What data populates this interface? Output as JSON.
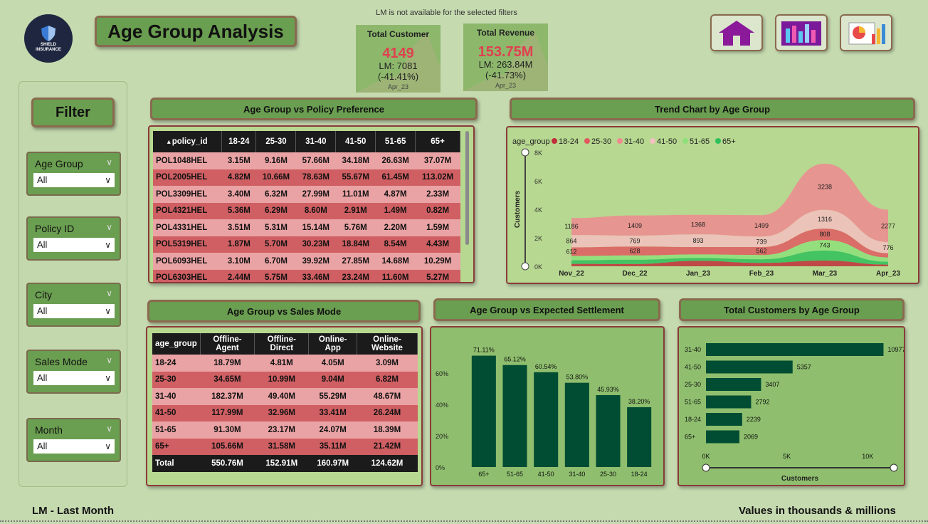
{
  "header": {
    "title": "Age Group Analysis",
    "logo_text": [
      "SHIELD",
      "INSURANCE"
    ],
    "notice": "LM is not available for the selected filters",
    "nav_buttons": [
      "home-icon",
      "dashboard-icon",
      "report-icon"
    ]
  },
  "kpis": [
    {
      "label": "Total Customer",
      "value": "4149",
      "lm": "LM: 7081",
      "change": "(-41.41%)",
      "date": "Apr_23"
    },
    {
      "label": "Total Revenue",
      "value": "153.75M",
      "lm": "LM: 263.84M",
      "change": "(-41.73%)",
      "date": "Apr_23"
    }
  ],
  "filters": {
    "title": "Filter",
    "slicers": [
      {
        "label": "Age Group",
        "value": "All"
      },
      {
        "label": "Policy ID",
        "value": "All"
      },
      {
        "label": "City",
        "value": "All"
      },
      {
        "label": "Sales Mode",
        "value": "All"
      },
      {
        "label": "Month",
        "value": "All"
      }
    ]
  },
  "policy_table": {
    "title": "Age Group vs Policy Preference",
    "columns": [
      "policy_id",
      "18-24",
      "25-30",
      "31-40",
      "41-50",
      "51-65",
      "65+"
    ],
    "rows": [
      [
        "POL1048HEL",
        "3.15M",
        "9.16M",
        "57.66M",
        "34.18M",
        "26.63M",
        "37.07M"
      ],
      [
        "POL2005HEL",
        "4.82M",
        "10.66M",
        "78.63M",
        "55.67M",
        "61.45M",
        "113.02M"
      ],
      [
        "POL3309HEL",
        "3.40M",
        "6.32M",
        "27.99M",
        "11.01M",
        "4.87M",
        "2.33M"
      ],
      [
        "POL4321HEL",
        "5.36M",
        "6.29M",
        "8.60M",
        "2.91M",
        "1.49M",
        "0.82M"
      ],
      [
        "POL4331HEL",
        "3.51M",
        "5.31M",
        "15.14M",
        "5.76M",
        "2.20M",
        "1.59M"
      ],
      [
        "POL5319HEL",
        "1.87M",
        "5.70M",
        "30.23M",
        "18.84M",
        "8.54M",
        "4.43M"
      ],
      [
        "POL6093HEL",
        "3.10M",
        "6.70M",
        "39.92M",
        "27.85M",
        "14.68M",
        "10.29M"
      ],
      [
        "POL6303HEL",
        "2.44M",
        "5.75M",
        "33.46M",
        "23.24M",
        "11.60M",
        "5.27M"
      ]
    ]
  },
  "sales_table": {
    "title": "Age Group vs Sales Mode",
    "columns": [
      "age_group",
      "Offline-Agent",
      "Offline-Direct",
      "Online-App",
      "Online-Website"
    ],
    "rows": [
      [
        "18-24",
        "18.79M",
        "4.81M",
        "4.05M",
        "3.09M"
      ],
      [
        "25-30",
        "34.65M",
        "10.99M",
        "9.04M",
        "6.82M"
      ],
      [
        "31-40",
        "182.37M",
        "49.40M",
        "55.29M",
        "48.67M"
      ],
      [
        "41-50",
        "117.99M",
        "32.96M",
        "33.41M",
        "26.24M"
      ],
      [
        "51-65",
        "91.30M",
        "23.17M",
        "24.07M",
        "18.39M"
      ],
      [
        "65+",
        "105.66M",
        "31.58M",
        "35.11M",
        "21.42M"
      ]
    ],
    "total": [
      "Total",
      "550.76M",
      "152.91M",
      "160.97M",
      "124.62M"
    ]
  },
  "footer": {
    "left": "LM - Last Month",
    "right": "Values in thousands & millions"
  },
  "chart_data": [
    {
      "type": "area",
      "title": "Trend Chart by Age Group",
      "legend_title": "age_group",
      "legend_position": "top-left",
      "ylabel": "Customers",
      "xlabel": "",
      "categories": [
        "Nov_22",
        "Dec_22",
        "Jan_23",
        "Feb_23",
        "Mar_23",
        "Apr_23"
      ],
      "yticks": [
        "0K",
        "2K",
        "4K",
        "6K",
        "8K"
      ],
      "ylim": [
        0,
        8000
      ],
      "series": [
        {
          "name": "18-24",
          "color": "#c0303a",
          "values": [
            170,
            160,
            380,
            240,
            400,
            120
          ]
        },
        {
          "name": "25-30",
          "color": "#e05a60",
          "values": [
            612,
            628,
            520,
            562,
            808,
            300
          ]
        },
        {
          "name": "31-40",
          "color": "#f08a90",
          "values": [
            1186,
            1409,
            1368,
            1499,
            3238,
            2277
          ]
        },
        {
          "name": "41-50",
          "color": "#f5c0c0",
          "values": [
            864,
            769,
            893,
            739,
            1316,
            776
          ]
        },
        {
          "name": "51-65",
          "color": "#8ee07a",
          "values": [
            300,
            300,
            250,
            300,
            743,
            300
          ]
        },
        {
          "name": "65+",
          "color": "#2fbf5a",
          "values": [
            250,
            300,
            200,
            250,
            700,
            200
          ]
        }
      ],
      "data_labels": {
        "Nov_22": [
          "1186",
          "864",
          "612"
        ],
        "Dec_22": [
          "1409",
          "769",
          "628"
        ],
        "Jan_23": [
          "1368",
          "893"
        ],
        "Feb_23": [
          "1499",
          "739",
          "562"
        ],
        "Mar_23": [
          "3238",
          "1316",
          "808",
          "743"
        ],
        "Apr_23": [
          "2277",
          "776"
        ]
      },
      "colors": {
        "legend": [
          "#c0303a",
          "#e05a60",
          "#f08a90",
          "#f5c0c0",
          "#8ee07a",
          "#2fbf5a"
        ]
      }
    },
    {
      "type": "bar",
      "title": "Age Group vs Expected Settlement",
      "categories": [
        "65+",
        "51-65",
        "41-50",
        "31-40",
        "25-30",
        "18-24"
      ],
      "values": [
        71.11,
        65.12,
        60.54,
        53.8,
        45.93,
        38.2
      ],
      "labels": [
        "71.11%",
        "65.12%",
        "60.54%",
        "53.80%",
        "45.93%",
        "38.20%"
      ],
      "yticks": [
        "0%",
        "20%",
        "40%",
        "60%"
      ],
      "ylim": [
        0,
        80
      ],
      "color": "#004d33"
    },
    {
      "type": "bar",
      "orientation": "horizontal",
      "title": "Total Customers by Age Group",
      "categories": [
        "31-40",
        "41-50",
        "25-30",
        "51-65",
        "18-24",
        "65+"
      ],
      "values": [
        10977,
        5357,
        3407,
        2792,
        2239,
        2069
      ],
      "xticks": [
        "0K",
        "5K",
        "10K"
      ],
      "xlim": [
        0,
        11000
      ],
      "xlabel": "Customers",
      "color": "#004d33"
    }
  ]
}
